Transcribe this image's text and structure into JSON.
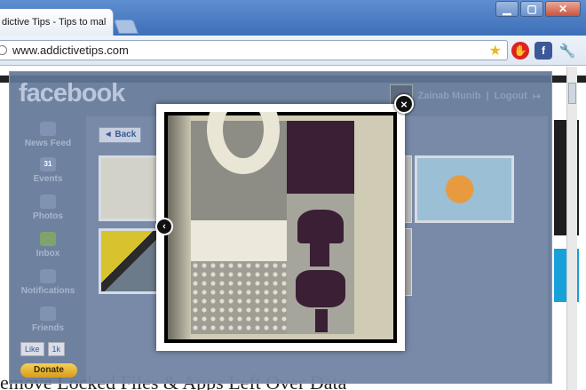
{
  "browser": {
    "tab_title": "dictive Tips - Tips to mal",
    "url": "www.addictivetips.com",
    "window_controls": {
      "minimize": "▁",
      "maximize": "▢",
      "close": "✕"
    },
    "icons": [
      "globe-icon",
      "bookmark-star-icon",
      "stop-extension-icon",
      "facebook-extension-icon",
      "wrench-icon"
    ]
  },
  "background_page": {
    "headline": "emove Locked Files & Apps Left Over Data"
  },
  "facebook": {
    "logo": "facebook",
    "user_name": "Zainab Munib",
    "separator": "|",
    "logout_label": "Logout",
    "logout_icon": "↦",
    "back_label": "◄ Back",
    "nav": [
      {
        "label": "News Feed",
        "icon": "house-icon"
      },
      {
        "label": "Events",
        "icon": "calendar-icon"
      },
      {
        "label": "Photos",
        "icon": "photos-icon"
      },
      {
        "label": "Inbox",
        "icon": "inbox-icon"
      },
      {
        "label": "Notifications",
        "icon": "notifications-icon"
      },
      {
        "label": "Friends",
        "icon": "friends-icon"
      }
    ],
    "calendar_day": "31",
    "like_label": "Like",
    "like_count": "1k",
    "donate_label": "Donate"
  },
  "lightbox": {
    "close_icon": "×",
    "prev_icon": "‹"
  }
}
